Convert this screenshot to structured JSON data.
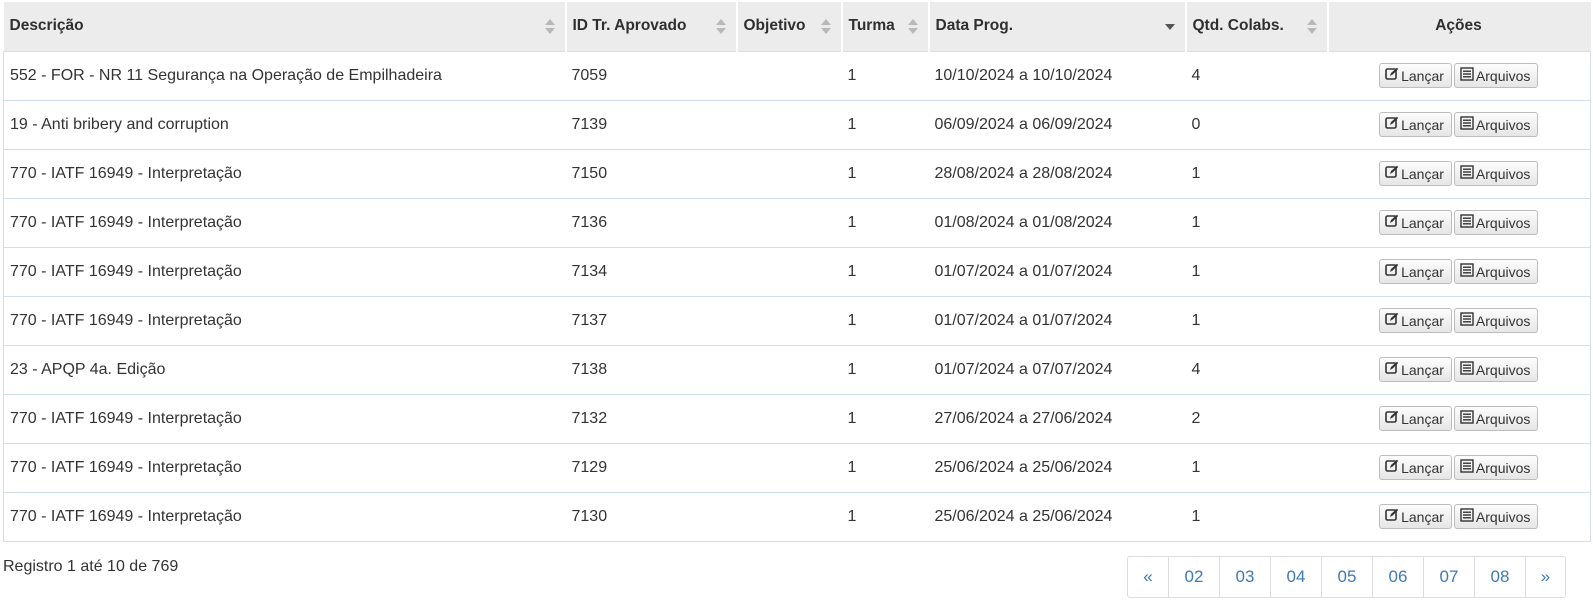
{
  "table": {
    "headers": {
      "descricao": "Descrição",
      "id_tr": "ID Tr. Aprovado",
      "objetivo": "Objetivo",
      "turma": "Turma",
      "data_prog": "Data Prog.",
      "qtd_colabs": "Qtd. Colabs.",
      "acoes": "Ações"
    },
    "buttons": {
      "lancar": "Lançar",
      "arquivos": "Arquivos"
    },
    "rows": [
      {
        "descricao": "552 - FOR - NR 11 Segurança na Operação de Empilhadeira",
        "id_tr": "7059",
        "objetivo": "",
        "turma": "1",
        "data_prog": "10/10/2024 a 10/10/2024",
        "qtd_colabs": "4"
      },
      {
        "descricao": "19 - Anti bribery and corruption",
        "id_tr": "7139",
        "objetivo": "",
        "turma": "1",
        "data_prog": "06/09/2024 a 06/09/2024",
        "qtd_colabs": "0"
      },
      {
        "descricao": "770 - IATF 16949 - Interpretação",
        "id_tr": "7150",
        "objetivo": "",
        "turma": "1",
        "data_prog": "28/08/2024 a 28/08/2024",
        "qtd_colabs": "1"
      },
      {
        "descricao": "770 - IATF 16949 - Interpretação",
        "id_tr": "7136",
        "objetivo": "",
        "turma": "1",
        "data_prog": "01/08/2024 a 01/08/2024",
        "qtd_colabs": "1"
      },
      {
        "descricao": "770 - IATF 16949 - Interpretação",
        "id_tr": "7134",
        "objetivo": "",
        "turma": "1",
        "data_prog": "01/07/2024 a 01/07/2024",
        "qtd_colabs": "1"
      },
      {
        "descricao": "770 - IATF 16949 - Interpretação",
        "id_tr": "7137",
        "objetivo": "",
        "turma": "1",
        "data_prog": "01/07/2024 a 01/07/2024",
        "qtd_colabs": "1"
      },
      {
        "descricao": "23 - APQP 4a. Edição",
        "id_tr": "7138",
        "objetivo": "",
        "turma": "1",
        "data_prog": "01/07/2024 a 07/07/2024",
        "qtd_colabs": "4"
      },
      {
        "descricao": "770 - IATF 16949 - Interpretação",
        "id_tr": "7132",
        "objetivo": "",
        "turma": "1",
        "data_prog": "27/06/2024 a 27/06/2024",
        "qtd_colabs": "2"
      },
      {
        "descricao": "770 - IATF 16949 - Interpretação",
        "id_tr": "7129",
        "objetivo": "",
        "turma": "1",
        "data_prog": "25/06/2024 a 25/06/2024",
        "qtd_colabs": "1"
      },
      {
        "descricao": "770 - IATF 16949 - Interpretação",
        "id_tr": "7130",
        "objetivo": "",
        "turma": "1",
        "data_prog": "25/06/2024 a 25/06/2024",
        "qtd_colabs": "1"
      }
    ]
  },
  "footer": {
    "info": "Registro 1 até 10 de 769"
  },
  "pagination": {
    "prev": "«",
    "pages": [
      "02",
      "03",
      "04",
      "05",
      "06",
      "07",
      "08"
    ],
    "next": "»"
  },
  "icons": {
    "lancar": "edit-icon",
    "arquivos": "list-icon"
  },
  "colors": {
    "header_bg": "#ececec",
    "row_border": "#cfe0ea",
    "link": "#3e7ab5"
  }
}
